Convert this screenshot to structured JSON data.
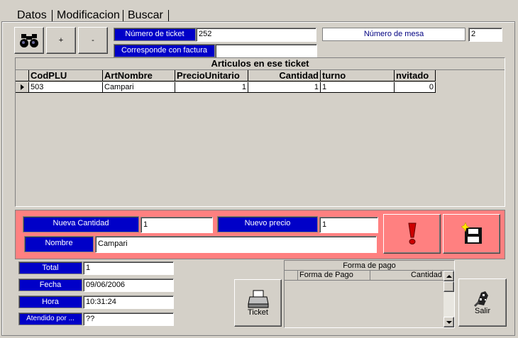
{
  "tabs": [
    "Datos",
    "Modificacion",
    "Buscar"
  ],
  "toolbar": {
    "plus_label": "+",
    "minus_label": "-"
  },
  "ticket": {
    "numero_label": "Número de ticket",
    "numero_value": "252",
    "factura_label": "Corresponde con factura",
    "factura_value": "",
    "mesa_label": "Número de mesa",
    "mesa_value": "2"
  },
  "articles": {
    "title": "Articulos en ese ticket",
    "columns": [
      "CodPLU",
      "ArtNombre",
      "PrecioUnitario",
      "Cantidad",
      "turno",
      "nvitado"
    ],
    "rows": [
      [
        "503",
        "Campari",
        "1",
        "1",
        "1",
        "0"
      ]
    ]
  },
  "edit": {
    "cantidad_label": "Nueva Cantidad",
    "cantidad_value": "1",
    "precio_label": "Nuevo precio",
    "precio_value": "1",
    "nombre_label": "Nombre",
    "nombre_value": "Campari"
  },
  "summary": {
    "total_label": "Total",
    "total_value": "1",
    "fecha_label": "Fecha",
    "fecha_value": "09/06/2006",
    "hora_label": "Hora",
    "hora_value": "10:31:24",
    "atendido_label": "Atendido por ...",
    "atendido_value": "??"
  },
  "actions": {
    "ticket_label": "Ticket",
    "salir_label": "Salir"
  },
  "payment": {
    "title": "Forma de pago",
    "columns": [
      "Forma de Pago",
      "Cantidad"
    ]
  },
  "colors": {
    "label_bg": "#0000c8",
    "edit_panel_bg": "#ff8080",
    "window_bg": "#d4d0c8"
  }
}
